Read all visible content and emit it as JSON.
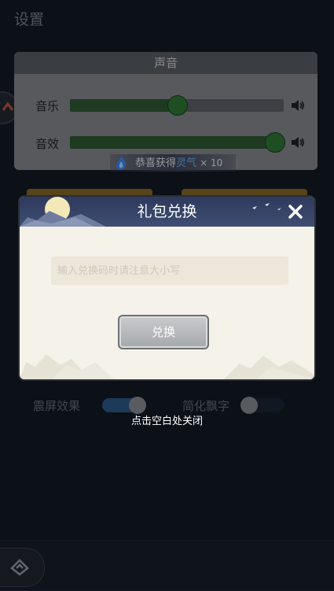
{
  "settings": {
    "title": "设置"
  },
  "sound": {
    "header": "声音",
    "music_label": "音乐",
    "music_level": 0.5,
    "sfx_label": "音效",
    "sfx_level": 0.98
  },
  "toast": {
    "prefix": "恭喜获得",
    "item": "灵气",
    "count": "× 10",
    "item_color": "#66b6ff",
    "icon": "blue-flame-icon"
  },
  "toggles": {
    "shake_label": "震屏效果",
    "shake_on": true,
    "simplify_label": "简化飘字",
    "simplify_on": false
  },
  "close_hint": "点击空白处关闭",
  "dialog": {
    "title": "礼包兑换",
    "input_placeholder": "输入兑换码时请注意大小写",
    "input_value": "",
    "redeem_label": "兑换",
    "close_icon": "close-icon"
  },
  "colors": {
    "slider_fill": "#2e5a2e",
    "slider_knob": "#2f7a30",
    "dialog_header": "#3f4d73",
    "dialog_body": "#f5f2ea",
    "toggle_on": "#2c5a8a"
  }
}
